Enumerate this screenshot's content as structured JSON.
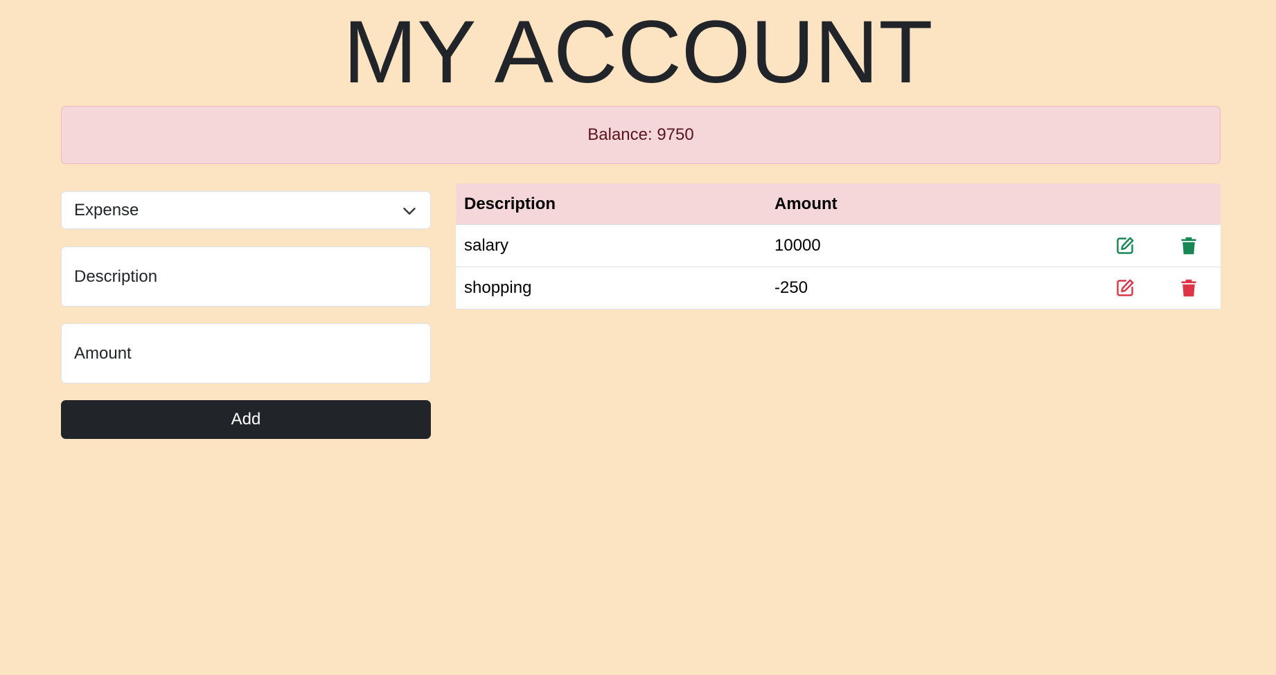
{
  "page": {
    "title": "MY ACCOUNT"
  },
  "balance": {
    "text": "Balance: 9750"
  },
  "form": {
    "type_select": {
      "selected": "Expense"
    },
    "description": {
      "placeholder": "Description"
    },
    "amount": {
      "placeholder": "Amount"
    },
    "add_label": "Add"
  },
  "table": {
    "headers": [
      "Description",
      "Amount"
    ],
    "rows": [
      {
        "description": "salary",
        "amount": "10000",
        "edit_icon": "edit-icon",
        "delete_icon": "trash-icon",
        "color": "#198754"
      },
      {
        "description": "shopping",
        "amount": "-250",
        "edit_icon": "edit-icon",
        "delete_icon": "trash-icon",
        "color": "#dc3545"
      }
    ]
  },
  "colors": {
    "background": "#fce3c2",
    "balance_bg": "#f5d6d9",
    "income": "#198754",
    "expense": "#dc3545",
    "button_dark": "#212529"
  }
}
